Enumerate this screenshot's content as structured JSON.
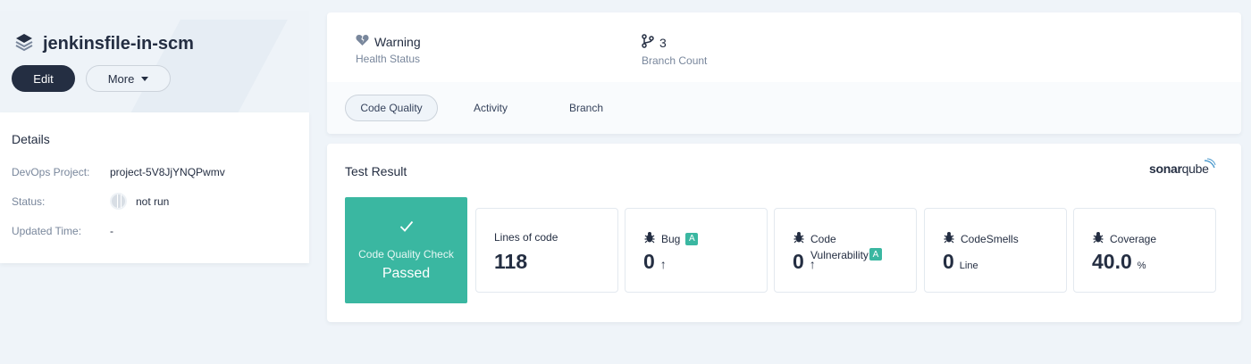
{
  "project": {
    "name": "jenkinsfile-in-scm",
    "edit_label": "Edit",
    "more_label": "More"
  },
  "details": {
    "heading": "Details",
    "rows": [
      {
        "label": "DevOps Project:",
        "value": "project-5V8JjYNQPwmv"
      },
      {
        "label": "Status:",
        "value": "not run"
      },
      {
        "label": "Updated Time:",
        "value": "-"
      }
    ]
  },
  "summary": {
    "health_value": "Warning",
    "health_label": "Health Status",
    "branch_value": "3",
    "branch_label": "Branch Count"
  },
  "tabs": [
    {
      "label": "Code Quality",
      "active": true
    },
    {
      "label": "Activity",
      "active": false
    },
    {
      "label": "Branch",
      "active": false
    }
  ],
  "result": {
    "title": "Test Result",
    "brand_a": "sonar",
    "brand_b": "qube",
    "check_label": "Code Quality Check",
    "check_status": "Passed",
    "metrics": [
      {
        "label": "Lines of code",
        "value": "118",
        "unit": ""
      },
      {
        "label": "Bug",
        "grade": "A",
        "value": "0",
        "unit": "↑"
      },
      {
        "label": "Code Vulnerability",
        "grade": "A",
        "value": "0",
        "unit": "↑"
      },
      {
        "label": "CodeSmells",
        "value": "0",
        "unit": "Line"
      },
      {
        "label": "Coverage",
        "value": "40.0",
        "unit": "%"
      }
    ]
  },
  "colors": {
    "accent_green": "#3ab7a1",
    "dark_button": "#242e42",
    "background": "#eff4f9"
  }
}
